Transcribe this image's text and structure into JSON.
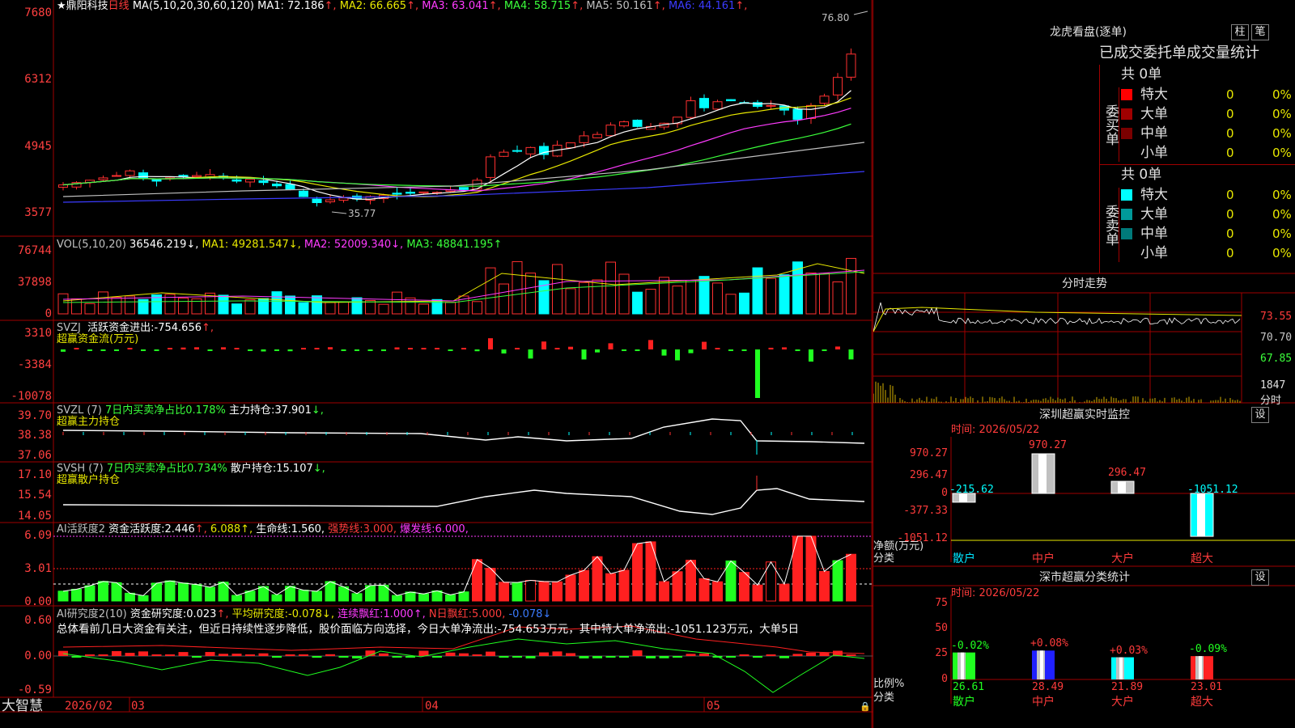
{
  "main": {
    "title_prefix": "★",
    "stock_name": "鼎阳科技",
    "period": "日线",
    "ma_params": "MA(5,10,20,30,60,120)",
    "ma": [
      {
        "label": "MA1:",
        "value": "72.186",
        "arrow": "↑",
        "color": "#ffffff"
      },
      {
        "label": "MA2:",
        "value": "66.665",
        "arrow": "↑",
        "color": "#e8e800"
      },
      {
        "label": "MA3:",
        "value": "63.041",
        "arrow": "↑",
        "color": "#ff3bff"
      },
      {
        "label": "MA4:",
        "value": "58.715",
        "arrow": "↑",
        "color": "#3bff3b"
      },
      {
        "label": "MA5:",
        "value": "50.161",
        "arrow": "↑",
        "color": "#c0c0c0"
      },
      {
        "label": "MA6:",
        "value": "44.161",
        "arrow": "↑",
        "color": "#3b3bff"
      }
    ],
    "y_ticks": [
      "7680",
      "6312",
      "4945",
      "3577"
    ],
    "high_label": "76.80",
    "low_label": "35.77"
  },
  "vol": {
    "params": "VOL(5,10,20)",
    "value": "36546.219",
    "ma1": "49281.547",
    "ma2": "52009.340",
    "ma3": "48841.195",
    "y_ticks": [
      "76744",
      "37898",
      "0"
    ]
  },
  "svzj": {
    "name": "SVZJ",
    "label": "活跃资金进出:",
    "value": "-754.656",
    "sub": "超赢资金流(万元)",
    "y_ticks": [
      "3310",
      "-3384",
      "-10078"
    ]
  },
  "svzl": {
    "name": "SVZL (7)",
    "pct_label": "7日内买卖净占比0.178%",
    "label": "主力持仓:",
    "value": "37.901",
    "sub": "超赢主力持仓",
    "y_ticks": [
      "39.70",
      "38.38",
      "37.06"
    ]
  },
  "svsh": {
    "name": "SVSH (7)",
    "pct_label": "7日内买卖净占比0.734%",
    "label": "散户持仓:",
    "value": "15.107",
    "sub": "超赢散户持仓",
    "y_ticks": [
      "17.10",
      "15.54",
      "14.05"
    ]
  },
  "ai1": {
    "name": "AI活跃度2",
    "label": "资金活跃度:",
    "value": "2.446",
    "v2": "6.088",
    "life_label": "生命线:",
    "life": "1.560",
    "strong_label": "强势线:",
    "strong": "3.000",
    "burst_label": "爆发线:",
    "burst": "6.000",
    "y_ticks": [
      "6.09",
      "3.01",
      "0.00"
    ]
  },
  "ai2": {
    "name": "AI研究度2(10)",
    "label": "资金研究度:",
    "value": "0.023",
    "avg_label": "平均研究度:",
    "avg": "-0.078",
    "red_label": "连续飘红:",
    "red": "1.000",
    "n_label": "N日飘红:",
    "n": "5.000",
    "extra": "-0.078",
    "summary": "总体看前几日大资金有关注，但近日持续性逐步降低，股价面临方向选择，今日大单净流出:-754.653万元，其中特大单净流出:-1051.123万元，大单5日",
    "y_ticks": [
      "0.60",
      "0.00",
      "-0.59"
    ]
  },
  "footer": {
    "brand": "大智慧",
    "dates": [
      "2026/02",
      "03",
      "04",
      "05"
    ]
  },
  "right": {
    "dragon": {
      "title": "龙虎看盘(逐单)",
      "btn1": "柱",
      "btn2": "笔",
      "header": "已成交委托单成交量统计",
      "buy_title": "委买单",
      "sell_title": "委卖单",
      "buy_total": "共 0单",
      "sell_total": "共 0单",
      "buy_rows": [
        {
          "label": "特大",
          "count": "0",
          "pct": "0%",
          "color": "#ff0000"
        },
        {
          "label": "大单",
          "count": "0",
          "pct": "0%",
          "color": "#a00000"
        },
        {
          "label": "中单",
          "count": "0",
          "pct": "0%",
          "color": "#7a0000"
        },
        {
          "label": "小单",
          "count": "0",
          "pct": "0%",
          "color": ""
        }
      ],
      "sell_rows": [
        {
          "label": "特大",
          "count": "0",
          "pct": "0%",
          "color": "#00ffff"
        },
        {
          "label": "大单",
          "count": "0",
          "pct": "0%",
          "color": "#009999"
        },
        {
          "label": "中单",
          "count": "0",
          "pct": "0%",
          "color": "#007a7a"
        },
        {
          "label": "小单",
          "count": "0",
          "pct": "0%",
          "color": ""
        }
      ]
    },
    "intraday": {
      "title": "分时走势",
      "y_ticks": [
        "73.55",
        "70.70",
        "67.85"
      ],
      "vol_tick": "1847",
      "vol_unit": "分时"
    },
    "sz_monitor": {
      "title": "深圳超赢实时监控",
      "btn": "设",
      "date_label": "时间: 2026/05/22",
      "y_ticks": [
        "970.27",
        "296.47",
        "0",
        "-377.33",
        "-1051.12"
      ],
      "y_unit": "净额(万元)",
      "x_unit": "分类",
      "bars": [
        {
          "label": "散户",
          "value": "-215.62"
        },
        {
          "label": "中户",
          "value": "970.27"
        },
        {
          "label": "大户",
          "value": "296.47"
        },
        {
          "label": "超大",
          "value": "-1051.12"
        }
      ]
    },
    "sz_class": {
      "title": "深市超赢分类统计",
      "btn": "设",
      "date_label": "时间: 2026/05/22",
      "y_ticks": [
        "75",
        "50",
        "25",
        "0"
      ],
      "y_unit": "比例%",
      "x_unit": "分类",
      "bars": [
        {
          "label": "散户",
          "value": "26.61",
          "delta": "-0.02%"
        },
        {
          "label": "中户",
          "value": "28.49",
          "delta": "+0.08%"
        },
        {
          "label": "大户",
          "value": "21.89",
          "delta": "+0.03%"
        },
        {
          "label": "超大",
          "value": "23.01",
          "delta": "-0.09%"
        }
      ]
    }
  }
}
